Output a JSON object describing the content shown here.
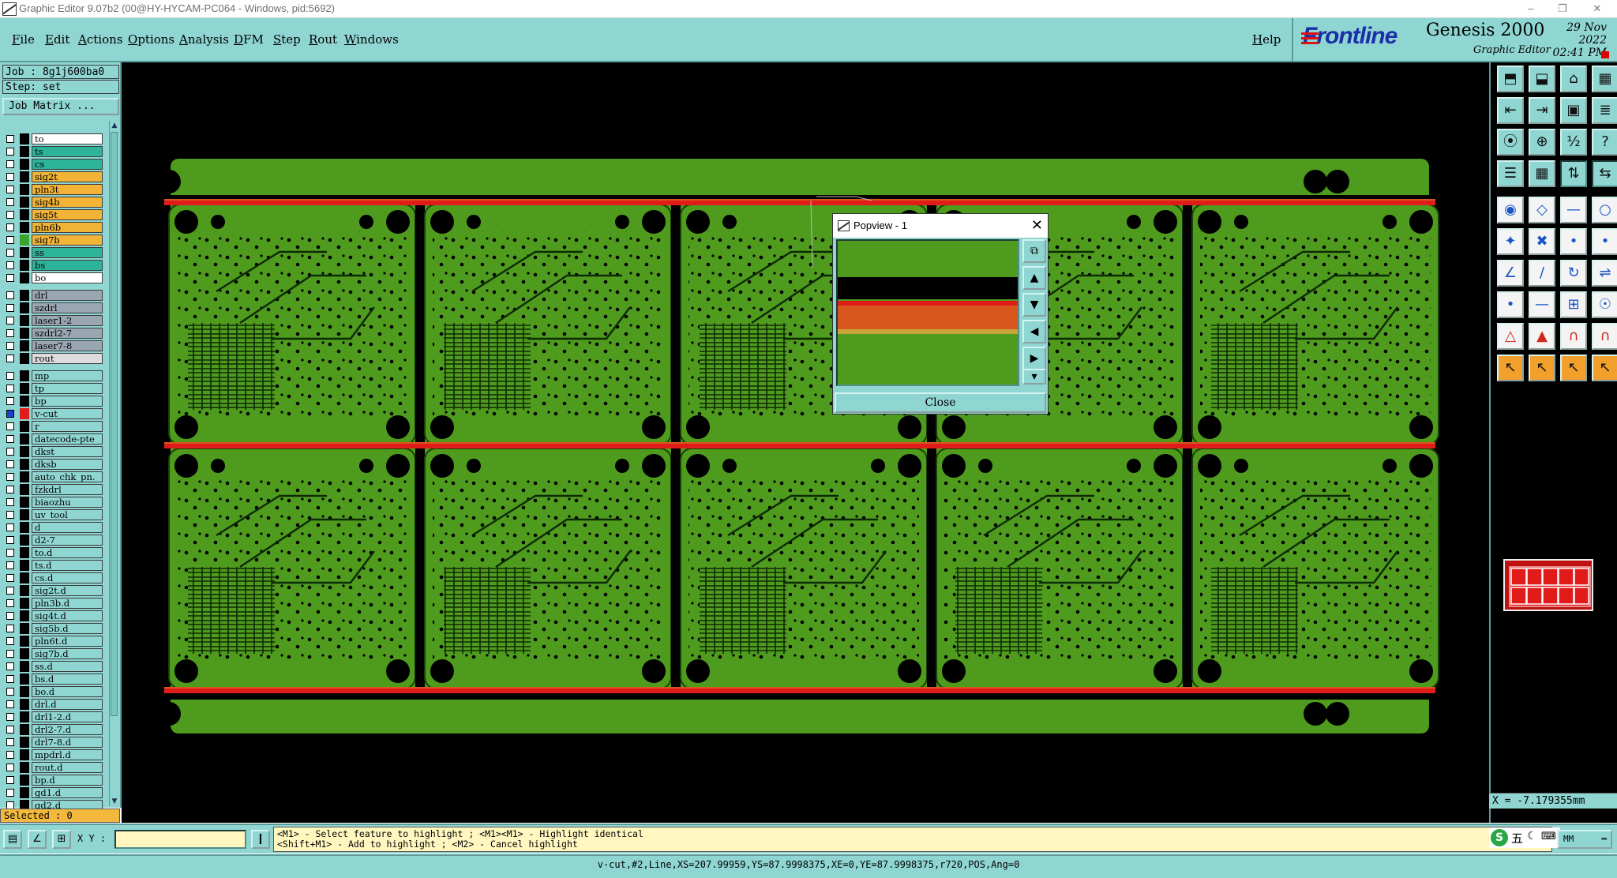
{
  "window": {
    "title": "Graphic Editor 9.07b2 (00@HY-HYCAM-PC064 - Windows, pid:5692)"
  },
  "menubar": {
    "items": [
      "File",
      "Edit",
      "Actions",
      "Options",
      "Analysis",
      "DFM",
      "Step",
      "Rout",
      "Windows"
    ],
    "help": "Help"
  },
  "logo": {
    "brand": "Frontline",
    "product": "Genesis 2000",
    "subtitle": "Graphic Editor",
    "date": "29 Nov 2022",
    "time": "02:41 PM"
  },
  "panel": {
    "job": "Job : 8g1j600ba0",
    "step": "Step: set",
    "job_matrix": "Job Matrix ...",
    "selected": "Selected : 0"
  },
  "layers": [
    {
      "name": "to",
      "color": "#ffffff",
      "swatch": "#000000"
    },
    {
      "name": "ts",
      "color": "#2db39a",
      "swatch": "#000000"
    },
    {
      "name": "cs",
      "color": "#2db39a",
      "swatch": "#000000"
    },
    {
      "name": "sig2t",
      "color": "#f2b336",
      "swatch": "#000000"
    },
    {
      "name": "pln3t",
      "color": "#f2b336",
      "swatch": "#000000"
    },
    {
      "name": "sig4b",
      "color": "#f2b336",
      "swatch": "#000000"
    },
    {
      "name": "sig5t",
      "color": "#f2b336",
      "swatch": "#000000"
    },
    {
      "name": "pln6b",
      "color": "#f2b336",
      "swatch": "#000000"
    },
    {
      "name": "sig7b",
      "color": "#f2b336",
      "swatch": "#3aa52a"
    },
    {
      "name": "ss",
      "color": "#2db39a",
      "swatch": "#000000"
    },
    {
      "name": "bs",
      "color": "#2db39a",
      "swatch": "#000000"
    },
    {
      "name": "bo",
      "color": "#ffffff",
      "swatch": "#000000"
    },
    {
      "name": "drl",
      "color": "#9aa7b2",
      "swatch": "#000000"
    },
    {
      "name": "szdrl",
      "color": "#9aa7b2",
      "swatch": "#000000"
    },
    {
      "name": "laser1-2",
      "color": "#9aa7b2",
      "swatch": "#000000"
    },
    {
      "name": "szdrl2-7",
      "color": "#9aa7b2",
      "swatch": "#000000"
    },
    {
      "name": "laser7-8",
      "color": "#9aa7b2",
      "swatch": "#000000"
    },
    {
      "name": "rout",
      "color": "#dcdcdc",
      "swatch": "#000000"
    },
    {
      "name": "mp",
      "color": "#8fd6d2",
      "swatch": "#000000"
    },
    {
      "name": "tp",
      "color": "#8fd6d2",
      "swatch": "#000000"
    },
    {
      "name": "bp",
      "color": "#8fd6d2",
      "swatch": "#000000"
    },
    {
      "name": "v-cut",
      "color": "#8fd6d2",
      "swatch": "#e11a1a"
    },
    {
      "name": "r",
      "color": "#8fd6d2",
      "swatch": "#000000"
    },
    {
      "name": "datecode-pte",
      "color": "#8fd6d2",
      "swatch": "#000000"
    },
    {
      "name": "dkst",
      "color": "#8fd6d2",
      "swatch": "#000000"
    },
    {
      "name": "dksb",
      "color": "#8fd6d2",
      "swatch": "#000000"
    },
    {
      "name": "auto_chk_pn.",
      "color": "#8fd6d2",
      "swatch": "#000000"
    },
    {
      "name": "fzkdrl",
      "color": "#8fd6d2",
      "swatch": "#000000"
    },
    {
      "name": "biaozhu",
      "color": "#8fd6d2",
      "swatch": "#000000"
    },
    {
      "name": "uv_tool",
      "color": "#8fd6d2",
      "swatch": "#000000"
    },
    {
      "name": "d",
      "color": "#8fd6d2",
      "swatch": "#000000"
    },
    {
      "name": "d2-7",
      "color": "#8fd6d2",
      "swatch": "#000000"
    },
    {
      "name": "to.d",
      "color": "#8fd6d2",
      "swatch": "#000000"
    },
    {
      "name": "ts.d",
      "color": "#8fd6d2",
      "swatch": "#000000"
    },
    {
      "name": "cs.d",
      "color": "#8fd6d2",
      "swatch": "#000000"
    },
    {
      "name": "sig2t.d",
      "color": "#8fd6d2",
      "swatch": "#000000"
    },
    {
      "name": "pln3b.d",
      "color": "#8fd6d2",
      "swatch": "#000000"
    },
    {
      "name": "sig4t.d",
      "color": "#8fd6d2",
      "swatch": "#000000"
    },
    {
      "name": "sig5b.d",
      "color": "#8fd6d2",
      "swatch": "#000000"
    },
    {
      "name": "pln6t.d",
      "color": "#8fd6d2",
      "swatch": "#000000"
    },
    {
      "name": "sig7b.d",
      "color": "#8fd6d2",
      "swatch": "#000000"
    },
    {
      "name": "ss.d",
      "color": "#8fd6d2",
      "swatch": "#000000"
    },
    {
      "name": "bs.d",
      "color": "#8fd6d2",
      "swatch": "#000000"
    },
    {
      "name": "bo.d",
      "color": "#8fd6d2",
      "swatch": "#000000"
    },
    {
      "name": "drl.d",
      "color": "#8fd6d2",
      "swatch": "#000000"
    },
    {
      "name": "drl1-2.d",
      "color": "#8fd6d2",
      "swatch": "#000000"
    },
    {
      "name": "drl2-7.d",
      "color": "#8fd6d2",
      "swatch": "#000000"
    },
    {
      "name": "drl7-8.d",
      "color": "#8fd6d2",
      "swatch": "#000000"
    },
    {
      "name": "mpdrl.d",
      "color": "#8fd6d2",
      "swatch": "#000000"
    },
    {
      "name": "rout.d",
      "color": "#8fd6d2",
      "swatch": "#000000"
    },
    {
      "name": "bp.d",
      "color": "#8fd6d2",
      "swatch": "#000000"
    },
    {
      "name": "gd1.d",
      "color": "#8fd6d2",
      "swatch": "#000000"
    },
    {
      "name": "gd2.d",
      "color": "#8fd6d2",
      "swatch": "#000000"
    }
  ],
  "popview": {
    "title": "Popview - 1",
    "close_label": "Close"
  },
  "toolbar": {
    "icons": [
      "open-step-icon",
      "save-icon",
      "home-icon",
      "layout-icon",
      "import-icon",
      "export-icon",
      "window-icon",
      "split-icon",
      "zoom-fit-icon",
      "zoom-center-icon",
      "scale-icon",
      "help-icon",
      "properties-icon",
      "grid-icon",
      "route-icon",
      "route-alt-icon",
      "pad-icon",
      "shape-icon",
      "line-icon",
      "circle-icon",
      "snap-icon",
      "cross-icon",
      "node-icon",
      "node-alt-icon",
      "angle-icon",
      "measure-icon",
      "rotate-icon",
      "flip-icon",
      "point-icon",
      "dash-icon",
      "box-icon",
      "group-icon",
      "triangle-icon",
      "triangle-alt-icon",
      "arch-icon",
      "arch-alt-icon",
      "pointer-icon",
      "pointer-select-icon",
      "pointer-move-icon",
      "pointer-measure-icon"
    ]
  },
  "coords": {
    "x_readout": "X = -7.179355mm"
  },
  "bottom": {
    "xy_label": "X Y :",
    "xy_value": "",
    "hint_line1": "<M1> - Select feature to highlight ; <M1><M1> - Highlight identical",
    "hint_line2": "<Shift+M1> - Add to highlight ; <M2> - Cancel highlight",
    "units": "MM",
    "ime": "五"
  },
  "status": "v-cut,#2,Line,XS=207.99959,YS=87.9998375,XE=0,YE=87.9998375,r720,POS,Ang=0",
  "colors": {
    "panel": "#8fd6d2",
    "board": "#4f9b1d",
    "vcut": "#e11a1a",
    "canvas": "#000000"
  }
}
